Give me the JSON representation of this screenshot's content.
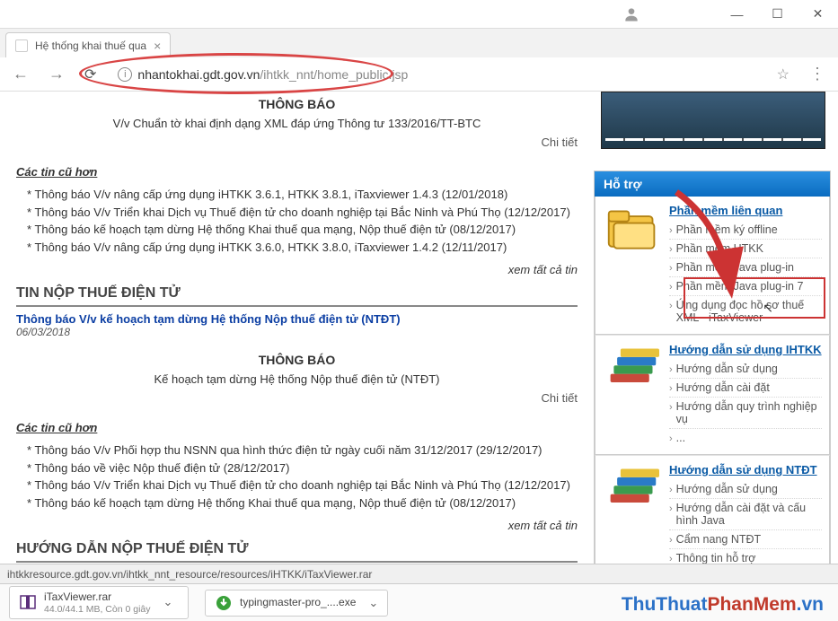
{
  "window": {
    "minimize_tooltip": "Minimize",
    "maximize_tooltip": "Maximize",
    "close_tooltip": "Close"
  },
  "tab": {
    "title": "Hệ thống khai thuế qua"
  },
  "url": {
    "host": "nhantokhai.gdt.gov.vn",
    "path": "/ihtkk_nnt/home_public.jsp"
  },
  "main": {
    "notice1_title": "THÔNG BÁO",
    "notice1_body": "V/v Chuẩn tờ khai định dạng XML đáp ứng Thông tư 133/2016/TT-BTC",
    "chitiet": "Chi tiết",
    "older_head": "Các tin cũ hơn",
    "older1": [
      "Thông báo V/v nâng cấp ứng dụng iHTKK 3.6.1, HTKK 3.8.1, iTaxviewer 1.4.3 (12/01/2018)",
      "Thông báo V/v Triển khai Dịch vụ Thuế điện tử cho doanh nghiệp tại Bắc Ninh và Phú Thọ (12/12/2017)",
      "Thông báo kế hoạch tạm dừng Hệ thống Khai thuế qua mạng, Nộp thuế điện tử (08/12/2017)",
      "Thông báo V/v nâng cấp ứng dụng iHTKK 3.6.0, HTKK 3.8.0, iTaxviewer 1.4.2 (12/11/2017)"
    ],
    "see_all": "xem tất cả tin",
    "section2": "TIN NỘP THUẾ ĐIỆN TỬ",
    "featured2": "Thông báo V/v kế hoạch tạm dừng Hệ thống Nộp thuế điện tử (NTĐT)",
    "featured2_date": "06/03/2018",
    "notice2_title": "THÔNG BÁO",
    "notice2_body": "Kế hoạch tạm dừng Hệ thống Nộp thuế điện tử (NTĐT)",
    "older2": [
      "Thông báo V/v Phối hợp thu NSNN qua hình thức điện tử ngày cuối năm 31/12/2017 (29/12/2017)",
      "Thông báo về việc Nộp thuế điện tử (28/12/2017)",
      "Thông báo V/v Triển khai Dịch vụ Thuế điện tử cho doanh nghiệp tại Bắc Ninh và Phú Thọ (12/12/2017)",
      "Thông báo kế hoạch tạm dừng Hệ thống Khai thuế qua mạng, Nộp thuế điện tử (08/12/2017)"
    ],
    "section3": "HƯỚNG DẪN NỘP THUẾ ĐIỆN TỬ"
  },
  "sidebar": {
    "support_title": "Hỗ trợ",
    "block1": {
      "title": "Phần mềm liên quan",
      "items": [
        "Phần mềm ký offline",
        "Phần mềm HTKK",
        "Phần mềm Java plug-in",
        "Phần mềm Java plug-in 7",
        "Ứng dụng đọc hồ sơ thuế XML - iTaxViewer"
      ]
    },
    "block2": {
      "title": "Hướng dẫn sử dụng IHTKK",
      "items": [
        "Hướng dẫn sử dụng",
        "Hướng dẫn cài đặt",
        "Hướng dẫn quy trình nghiệp vụ",
        "..."
      ]
    },
    "block3": {
      "title": "Hướng dẫn sử dụng NTĐT",
      "items": [
        "Hướng dẫn sử dụng",
        "Hướng dẫn cài đặt và cấu hình Java",
        "Cẩm nang NTĐT",
        "Thông tin hỗ trợ"
      ]
    }
  },
  "status": "ihtkkresource.gdt.gov.vn/ihtkk_nnt_resource/resources/iHTKK/iTaxViewer.rar",
  "downloads": {
    "d1_name": "iTaxViewer.rar",
    "d1_sub": "44.0/44.1 MB, Còn 0 giây",
    "d2_name": "typingmaster-pro_....exe"
  },
  "watermark": {
    "p1": "ThuThuat",
    "p2": "PhanMem",
    "p3": ".vn"
  }
}
